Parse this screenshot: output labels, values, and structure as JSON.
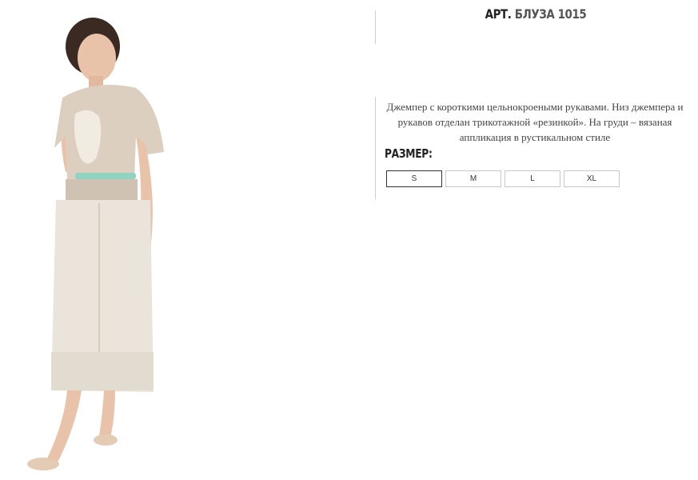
{
  "product": {
    "article_prefix": "АРТ.",
    "article_name": "БЛУЗА 1015",
    "description": "Джемпер  с короткими цельнокроеными рукавами. Низ джемпера и рукавов отделан трикотажной «резинкой». На груди – вязаная аппликация в рустикальном стиле",
    "size_label": "РАЗМЕР:",
    "sizes": [
      "S",
      "M",
      "L",
      "XL"
    ],
    "selected_size": "S"
  },
  "colors": {
    "sweater": "#dccfc0",
    "skirt": "#eae4da",
    "belt": "#8fd3c0",
    "hair": "#3a2a22",
    "skin": "#e8c3aa",
    "shoes": "#e3cbb4",
    "divider": "#cfcfcf"
  }
}
